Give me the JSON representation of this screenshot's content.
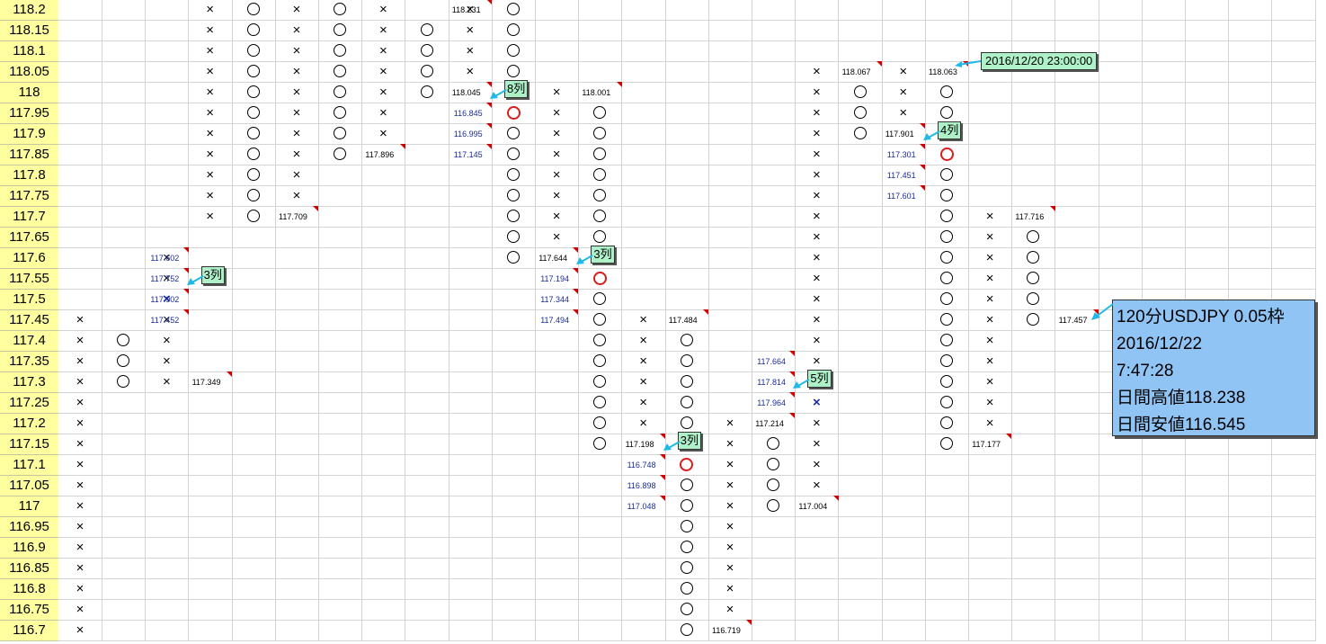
{
  "price_rows": [
    "118.2",
    "118.15",
    "118.1",
    "118.05",
    "118",
    "117.95",
    "117.9",
    "117.85",
    "117.8",
    "117.75",
    "117.7",
    "117.65",
    "117.6",
    "117.55",
    "117.5",
    "117.45",
    "117.4",
    "117.35",
    "117.3",
    "117.25",
    "117.2",
    "117.15",
    "117.1",
    "117.05",
    "117",
    "116.95",
    "116.9",
    "116.85",
    "116.8",
    "116.75",
    "116.7"
  ],
  "columns": [
    {
      "type": "x",
      "from": "116.7",
      "to": "117.45"
    },
    {
      "type": "o",
      "from": "117.3",
      "to": "117.4"
    },
    {
      "type": "x",
      "from": "117.3",
      "to": "117.6",
      "blue": "117.5"
    },
    {
      "type": "x",
      "from": "117.7",
      "to": "118.2"
    },
    {
      "type": "o",
      "from": "117.7",
      "to": "118.2"
    },
    {
      "type": "x",
      "from": "117.75",
      "to": "118.2"
    },
    {
      "type": "o",
      "from": "117.85",
      "to": "118.2"
    },
    {
      "type": "x",
      "from": "117.9",
      "to": "118.2"
    },
    {
      "type": "o",
      "from": "118",
      "to": "118.15"
    },
    {
      "type": "x",
      "from": "118.05",
      "to": "118.2"
    },
    {
      "type": "o",
      "from": "117.6",
      "to": "118.2",
      "red": "117.95"
    },
    {
      "type": "x",
      "from": "117.65",
      "to": "118"
    },
    {
      "type": "o",
      "from": "117.15",
      "to": "117.95",
      "red": "117.55"
    },
    {
      "type": "x",
      "from": "117.2",
      "to": "117.45"
    },
    {
      "type": "o",
      "from": "116.7",
      "to": "117.4",
      "red": "117.1"
    },
    {
      "type": "x",
      "from": "116.75",
      "to": "117.2"
    },
    {
      "type": "o",
      "from": "117",
      "to": "117.15"
    },
    {
      "type": "x",
      "from": "117.05",
      "to": "118.05",
      "blue": "117.25"
    },
    {
      "type": "o",
      "from": "117.9",
      "to": "118"
    },
    {
      "type": "x",
      "from": "117.95",
      "to": "118.05"
    },
    {
      "type": "o",
      "from": "117.15",
      "to": "118",
      "red": "117.85"
    },
    {
      "type": "x",
      "from": "117.2",
      "to": "117.7"
    },
    {
      "type": "o",
      "from": "117.45",
      "to": "117.65"
    }
  ],
  "notes": [
    {
      "col": 2,
      "row": "117.6",
      "text": "117.602",
      "blue": true
    },
    {
      "col": 2,
      "row": "117.55",
      "text": "117.752",
      "blue": true
    },
    {
      "col": 2,
      "row": "117.5",
      "text": "117.902",
      "blue": true
    },
    {
      "col": 2,
      "row": "117.45",
      "text": "117.452",
      "blue": true
    },
    {
      "col": 3,
      "row": "117.3",
      "text": "117.349"
    },
    {
      "col": 5,
      "row": "117.7",
      "text": "117.709"
    },
    {
      "col": 7,
      "row": "117.85",
      "text": "117.896"
    },
    {
      "col": 9,
      "row": "118.2",
      "text": "118.231"
    },
    {
      "col": 9,
      "row": "118",
      "text": "118.045"
    },
    {
      "col": 9,
      "row": "117.95",
      "text": "116.845",
      "blue": true
    },
    {
      "col": 9,
      "row": "117.9",
      "text": "116.995",
      "blue": true
    },
    {
      "col": 9,
      "row": "117.85",
      "text": "117.145",
      "blue": true
    },
    {
      "col": 12,
      "row": "118",
      "text": "118.001"
    },
    {
      "col": 11,
      "row": "117.6",
      "text": "117.644"
    },
    {
      "col": 11,
      "row": "117.55",
      "text": "117.194",
      "blue": true
    },
    {
      "col": 11,
      "row": "117.5",
      "text": "117.344",
      "blue": true
    },
    {
      "col": 11,
      "row": "117.45",
      "text": "117.494",
      "blue": true
    },
    {
      "col": 14,
      "row": "117.45",
      "text": "117.484"
    },
    {
      "col": 13,
      "row": "117.15",
      "text": "117.198"
    },
    {
      "col": 13,
      "row": "117.1",
      "text": "116.748",
      "blue": true
    },
    {
      "col": 13,
      "row": "117.05",
      "text": "116.898",
      "blue": true
    },
    {
      "col": 13,
      "row": "117",
      "text": "117.048",
      "blue": true
    },
    {
      "col": 15,
      "row": "116.7",
      "text": "116.719"
    },
    {
      "col": 16,
      "row": "117.35",
      "text": "117.664",
      "blue": true
    },
    {
      "col": 16,
      "row": "117.3",
      "text": "117.814",
      "blue": true
    },
    {
      "col": 16,
      "row": "117.25",
      "text": "117.964",
      "blue": true
    },
    {
      "col": 16,
      "row": "117.2",
      "text": "117.214"
    },
    {
      "col": 17,
      "row": "117",
      "text": "117.004"
    },
    {
      "col": 18,
      "row": "118.05",
      "text": "118.067"
    },
    {
      "col": 19,
      "row": "117.9",
      "text": "117.901"
    },
    {
      "col": 19,
      "row": "117.85",
      "text": "117.301",
      "blue": true
    },
    {
      "col": 19,
      "row": "117.8",
      "text": "117.451",
      "blue": true
    },
    {
      "col": 19,
      "row": "117.75",
      "text": "117.601",
      "blue": true
    },
    {
      "col": 20,
      "row": "118.05",
      "text": "118.063"
    },
    {
      "col": 22,
      "row": "117.7",
      "text": "117.716"
    },
    {
      "col": 21,
      "row": "117.15",
      "text": "117.177"
    },
    {
      "col": 23,
      "row": "117.45",
      "text": "117.457"
    }
  ],
  "callouts": [
    {
      "col": 3,
      "row": "117.55",
      "text": "3列"
    },
    {
      "col": 10,
      "row": "118",
      "text": "8列"
    },
    {
      "col": 12,
      "row": "117.6",
      "text": "3列"
    },
    {
      "col": 14,
      "row": "117.15",
      "text": "3列"
    },
    {
      "col": 17,
      "row": "117.3",
      "text": "5列"
    },
    {
      "col": 20,
      "row": "117.9",
      "text": "4列"
    }
  ],
  "date_tip": "2016/12/20 23:00:00",
  "info": {
    "line1": "120分USDJPY 0.05枠",
    "line2": "2016/12/22",
    "line3": "7:47:28",
    "line4": "日間高値118.238",
    "line5": "日間安値116.545"
  }
}
